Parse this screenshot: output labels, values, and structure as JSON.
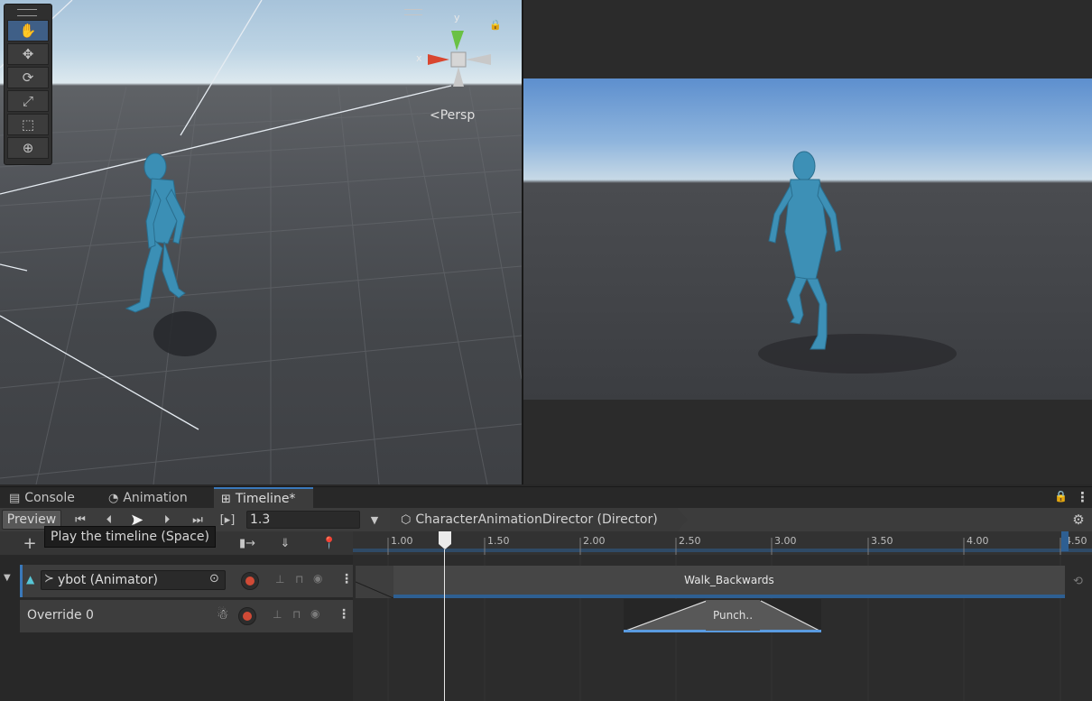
{
  "scene": {
    "persp_label": "<Persp",
    "gizmo": {
      "y_label": "y",
      "x_label": "x"
    },
    "tools": [
      {
        "name": "hand-tool",
        "icon": "hand-icon",
        "glyph": "✋",
        "active": true
      },
      {
        "name": "move-tool",
        "icon": "move-icon",
        "glyph": "✥",
        "active": false
      },
      {
        "name": "rotate-tool",
        "icon": "rotate-icon",
        "glyph": "⟳",
        "active": false
      },
      {
        "name": "scale-tool",
        "icon": "scale-icon",
        "glyph": "⤢",
        "active": false
      },
      {
        "name": "rect-tool",
        "icon": "rect-icon",
        "glyph": "⬚",
        "active": false
      },
      {
        "name": "transform-tool",
        "icon": "transform-icon",
        "glyph": "⊕",
        "active": false
      }
    ]
  },
  "tabs": [
    {
      "label": "Console",
      "icon": "console-icon",
      "glyph": "▤",
      "active": false
    },
    {
      "label": "Animation",
      "icon": "animation-icon",
      "glyph": "◔",
      "active": false
    },
    {
      "label": "Timeline*",
      "icon": "timeline-icon",
      "glyph": "⊞",
      "active": true
    }
  ],
  "toolbar": {
    "preview_label": "Preview",
    "current_time": "1.3",
    "director_label": "CharacterAnimationDirector (Director)"
  },
  "tooltip": "Play the timeline (Space)",
  "ruler": {
    "ticks": [
      "1.00",
      "1.50",
      "2.00",
      "2.50",
      "3.00",
      "3.50",
      "4.00",
      "4.50"
    ]
  },
  "tracks": {
    "animator_track": "ybot (Animator)",
    "override_track": "Override 0"
  },
  "clips": {
    "walk": "Walk_Backwards",
    "punch": "Punch.."
  },
  "colors": {
    "accent": "#3a79bb",
    "record": "#d04a36",
    "clip_bar": "#2e5f92",
    "track_marker": "#57c6d6"
  }
}
